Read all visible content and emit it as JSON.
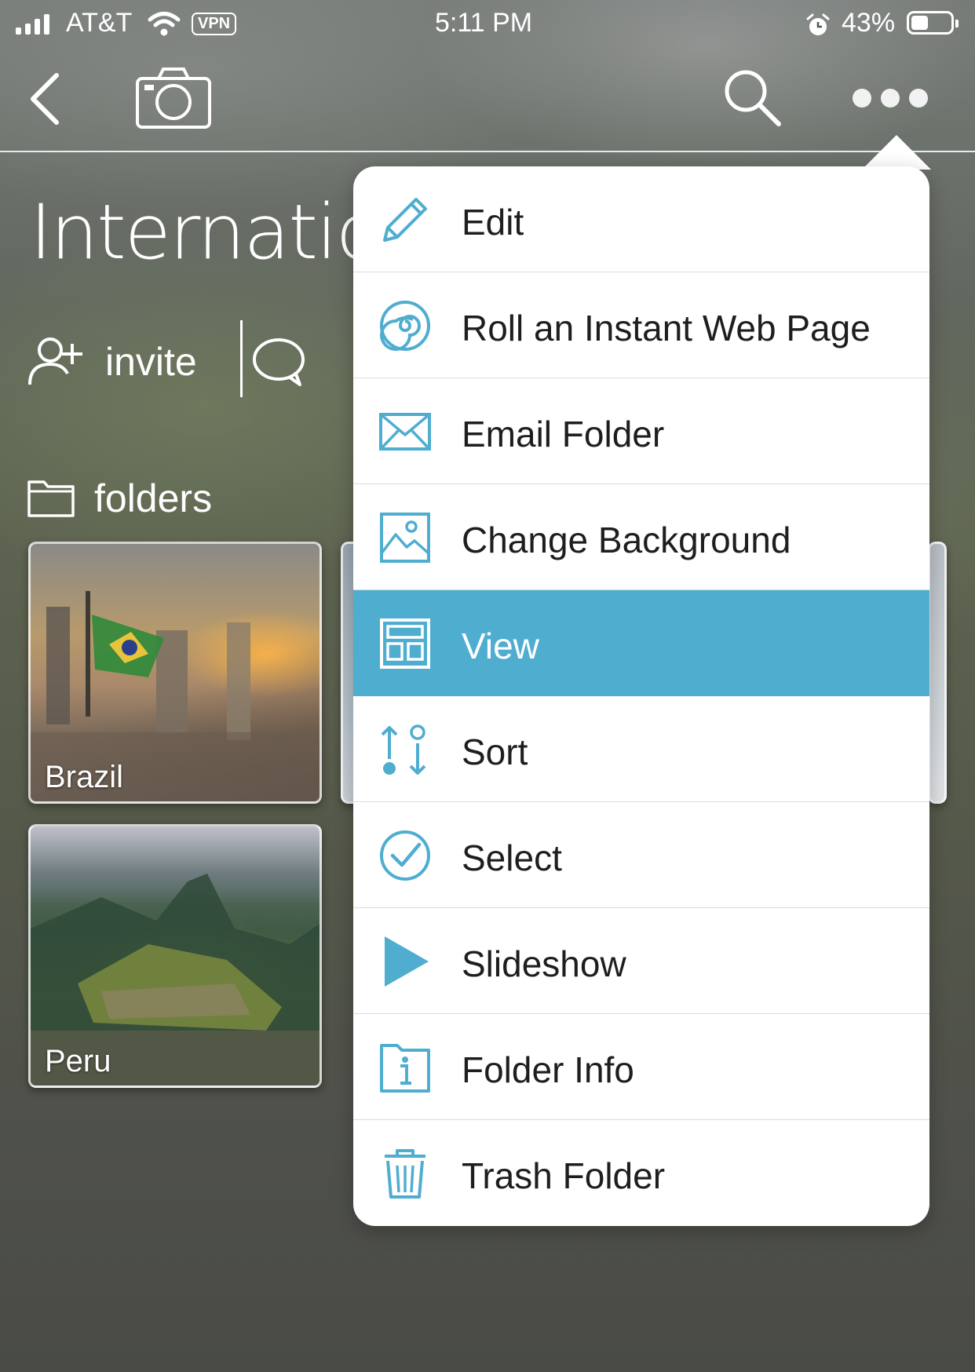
{
  "status_bar": {
    "carrier": "AT&T",
    "vpn": "VPN",
    "time": "5:11 PM",
    "battery": "43%",
    "battery_level": 0.43
  },
  "header": {
    "title": "Internation",
    "invite_label": "invite",
    "folders_label": "folders"
  },
  "folders": [
    {
      "name": "Brazil"
    },
    {
      "name": "Peru"
    }
  ],
  "menu": {
    "accent_color": "#4fadd0",
    "selected": "View",
    "items": [
      {
        "label": "Edit",
        "icon": "pencil-icon"
      },
      {
        "label": "Roll an Instant Web Page",
        "icon": "spiral-icon"
      },
      {
        "label": "Email Folder",
        "icon": "envelope-icon"
      },
      {
        "label": "Change Background",
        "icon": "image-icon"
      },
      {
        "label": "View",
        "icon": "layout-icon"
      },
      {
        "label": "Sort",
        "icon": "sort-icon"
      },
      {
        "label": "Select",
        "icon": "checkmark-circle-icon"
      },
      {
        "label": "Slideshow",
        "icon": "play-icon"
      },
      {
        "label": "Folder Info",
        "icon": "info-folder-icon"
      },
      {
        "label": "Trash Folder",
        "icon": "trash-icon"
      }
    ]
  }
}
